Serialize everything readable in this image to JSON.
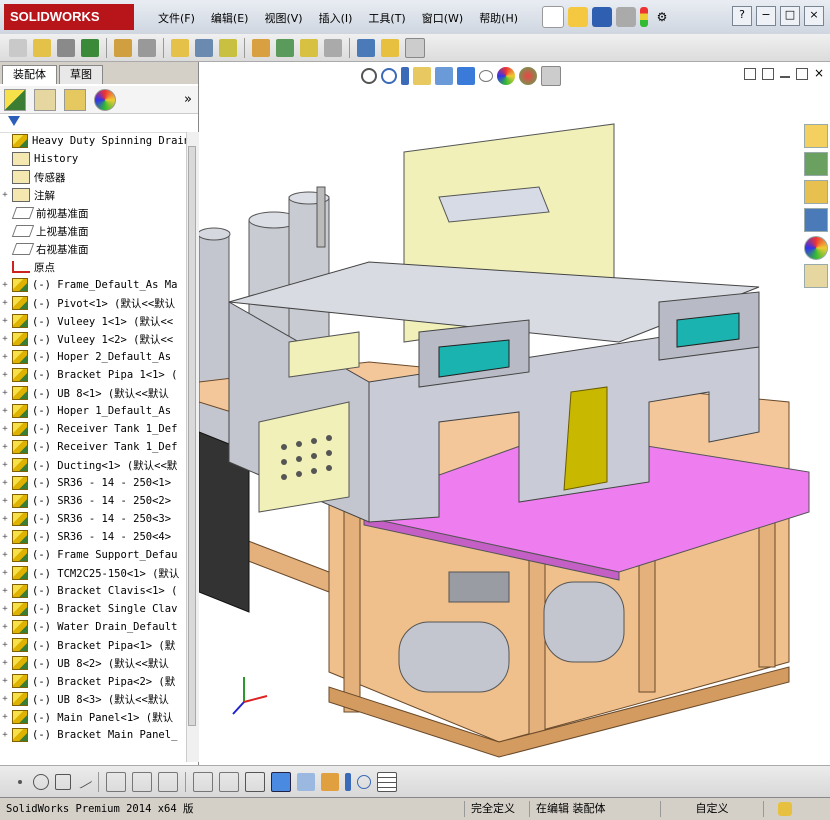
{
  "titlebar": {
    "logo_text": "SOLIDWORKS",
    "menus": [
      "文件(F)",
      "编辑(E)",
      "视图(V)",
      "插入(I)",
      "工具(T)",
      "窗口(W)",
      "帮助(H)"
    ],
    "window_controls": [
      "?",
      "−",
      "□",
      "×"
    ]
  },
  "left_panel": {
    "tabs": [
      "装配体",
      "草图"
    ],
    "active_tab": "装配体",
    "filter_icon": "filter-icon",
    "expand_label": "»",
    "tree": [
      {
        "label": "Heavy Duty Spinning Drain |",
        "icon": "assembly",
        "expander": false
      },
      {
        "label": "History",
        "icon": "history",
        "expander": false
      },
      {
        "label": "传感器",
        "icon": "sensor",
        "expander": false
      },
      {
        "label": "注解",
        "icon": "annotation",
        "expander": true
      },
      {
        "label": "前视基准面",
        "icon": "plane",
        "expander": false
      },
      {
        "label": "上视基准面",
        "icon": "plane",
        "expander": false
      },
      {
        "label": "右视基准面",
        "icon": "plane",
        "expander": false
      },
      {
        "label": "原点",
        "icon": "origin",
        "expander": false
      },
      {
        "label": "(-) Frame_Default_As Ma",
        "icon": "part",
        "expander": true
      },
      {
        "label": "(-) Pivot<1> (默认<<默认",
        "icon": "part",
        "expander": true
      },
      {
        "label": "(-) Vuleey 1<1> (默认<<",
        "icon": "part",
        "expander": true
      },
      {
        "label": "(-) Vuleey 1<2> (默认<<",
        "icon": "part",
        "expander": true
      },
      {
        "label": "(-) Hoper 2_Default_As",
        "icon": "part",
        "expander": true
      },
      {
        "label": "(-) Bracket Pipa 1<1> (",
        "icon": "part",
        "expander": true
      },
      {
        "label": "(-) UB 8<1> (默认<<默认",
        "icon": "part",
        "expander": true
      },
      {
        "label": "(-) Hoper 1_Default_As",
        "icon": "part",
        "expander": true
      },
      {
        "label": "(-) Receiver Tank 1_Def",
        "icon": "part",
        "expander": true
      },
      {
        "label": "(-) Receiver Tank 1_Def",
        "icon": "part",
        "expander": true
      },
      {
        "label": "(-) Ducting<1> (默认<<默",
        "icon": "part",
        "expander": true
      },
      {
        "label": "(-) SR36 - 14 - 250<1>",
        "icon": "part",
        "expander": true
      },
      {
        "label": "(-) SR36 - 14 - 250<2>",
        "icon": "part",
        "expander": true
      },
      {
        "label": "(-) SR36 - 14 - 250<3>",
        "icon": "part",
        "expander": true
      },
      {
        "label": "(-) SR36 - 14 - 250<4>",
        "icon": "part",
        "expander": true
      },
      {
        "label": "(-) Frame Support_Defau",
        "icon": "part",
        "expander": true
      },
      {
        "label": "(-) TCM2C25-150<1> (默认",
        "icon": "part",
        "expander": true
      },
      {
        "label": "(-) Bracket Clavis<1> (",
        "icon": "part",
        "expander": true
      },
      {
        "label": "(-) Bracket Single Clav",
        "icon": "part",
        "expander": true
      },
      {
        "label": "(-) Water Drain_Default",
        "icon": "part",
        "expander": true
      },
      {
        "label": "(-) Bracket Pipa<1> (默",
        "icon": "part",
        "expander": true
      },
      {
        "label": "(-) UB 8<2> (默认<<默认",
        "icon": "part",
        "expander": true
      },
      {
        "label": "(-) Bracket Pipa<2> (默",
        "icon": "part",
        "expander": true
      },
      {
        "label": "(-) UB 8<3> (默认<<默认",
        "icon": "part",
        "expander": true
      },
      {
        "label": "(-) Main Panel<1> (默认",
        "icon": "part",
        "expander": true
      },
      {
        "label": "(-) Bracket Main Panel_",
        "icon": "part",
        "expander": true
      }
    ]
  },
  "statusbar": {
    "version": "SolidWorks Premium 2014 x64 版",
    "state1": "完全定义",
    "state2": "在编辑 装配体",
    "state3": "自定义"
  },
  "colors": {
    "accent": "#b8151b",
    "machine_body": "#c9ccd6",
    "magenta_plate": "#ee7df0",
    "wood_frame": "#e2b27e",
    "cabinet": "#f0f0b8",
    "teal_window": "#1ab3b0",
    "olive_strip": "#c8b800"
  }
}
